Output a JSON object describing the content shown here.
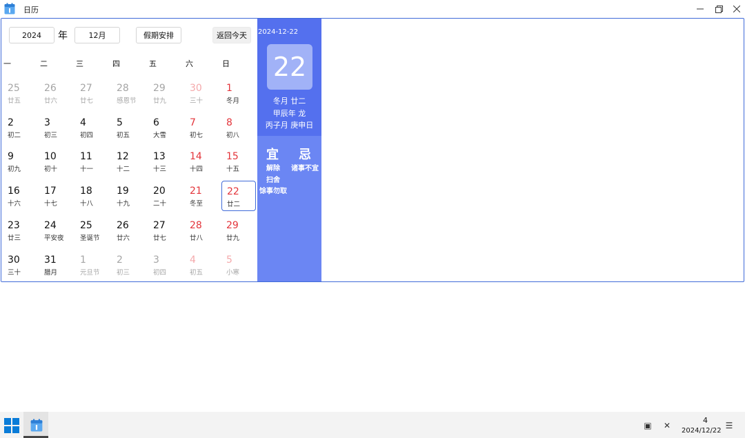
{
  "window": {
    "title": "日历"
  },
  "controls": {
    "year_value": "2024",
    "year_unit": "年",
    "month_value": "12月",
    "holiday_button": "假期安排",
    "today_button": "返回今天"
  },
  "weekdays": [
    "一",
    "二",
    "三",
    "四",
    "五",
    "六",
    "日"
  ],
  "weeks": [
    [
      {
        "n": "25",
        "s": "廿五",
        "other": true
      },
      {
        "n": "26",
        "s": "廿六",
        "other": true
      },
      {
        "n": "27",
        "s": "廿七",
        "other": true
      },
      {
        "n": "28",
        "s": "感恩节",
        "other": true
      },
      {
        "n": "29",
        "s": "廿九",
        "other": true
      },
      {
        "n": "30",
        "s": "三十",
        "other": true
      },
      {
        "n": "1",
        "s": "冬月",
        "other": false
      }
    ],
    [
      {
        "n": "2",
        "s": "初二",
        "other": false
      },
      {
        "n": "3",
        "s": "初三",
        "other": false
      },
      {
        "n": "4",
        "s": "初四",
        "other": false
      },
      {
        "n": "5",
        "s": "初五",
        "other": false
      },
      {
        "n": "6",
        "s": "大雪",
        "other": false
      },
      {
        "n": "7",
        "s": "初七",
        "other": false
      },
      {
        "n": "8",
        "s": "初八",
        "other": false
      }
    ],
    [
      {
        "n": "9",
        "s": "初九",
        "other": false
      },
      {
        "n": "10",
        "s": "初十",
        "other": false
      },
      {
        "n": "11",
        "s": "十一",
        "other": false
      },
      {
        "n": "12",
        "s": "十二",
        "other": false
      },
      {
        "n": "13",
        "s": "十三",
        "other": false
      },
      {
        "n": "14",
        "s": "十四",
        "other": false
      },
      {
        "n": "15",
        "s": "十五",
        "other": false
      }
    ],
    [
      {
        "n": "16",
        "s": "十六",
        "other": false
      },
      {
        "n": "17",
        "s": "十七",
        "other": false
      },
      {
        "n": "18",
        "s": "十八",
        "other": false
      },
      {
        "n": "19",
        "s": "十九",
        "other": false
      },
      {
        "n": "20",
        "s": "二十",
        "other": false
      },
      {
        "n": "21",
        "s": "冬至",
        "other": false
      },
      {
        "n": "22",
        "s": "廿二",
        "other": false,
        "selected": true
      }
    ],
    [
      {
        "n": "23",
        "s": "廿三",
        "other": false
      },
      {
        "n": "24",
        "s": "平安夜",
        "other": false
      },
      {
        "n": "25",
        "s": "圣诞节",
        "other": false
      },
      {
        "n": "26",
        "s": "廿六",
        "other": false
      },
      {
        "n": "27",
        "s": "廿七",
        "other": false
      },
      {
        "n": "28",
        "s": "廿八",
        "other": false
      },
      {
        "n": "29",
        "s": "廿九",
        "other": false
      }
    ],
    [
      {
        "n": "30",
        "s": "三十",
        "other": false
      },
      {
        "n": "31",
        "s": "腊月",
        "other": false
      },
      {
        "n": "1",
        "s": "元旦节",
        "other": true
      },
      {
        "n": "2",
        "s": "初三",
        "other": true
      },
      {
        "n": "3",
        "s": "初四",
        "other": true
      },
      {
        "n": "4",
        "s": "初五",
        "other": true
      },
      {
        "n": "5",
        "s": "小寒",
        "other": true
      }
    ]
  ],
  "info": {
    "date": "2024-12-22",
    "day": "22",
    "lunar_date": "冬月 廿二",
    "ganzhi_year": "甲辰年 龙",
    "ganzhi_month_day": "丙子月 庚申日",
    "yi_title": "宜",
    "ji_title": "忌",
    "yi_items": [
      "解除",
      "扫舍",
      "馀事勿取"
    ],
    "ji_items": [
      "诸事不宜"
    ]
  },
  "taskbar": {
    "date": "2024/12/22",
    "time_partial": "4"
  },
  "colors": {
    "accent": "#3f6ad8",
    "panel_dark": "#5470ee",
    "panel_light": "#6b86f3",
    "weekend_red": "#e3343a"
  }
}
